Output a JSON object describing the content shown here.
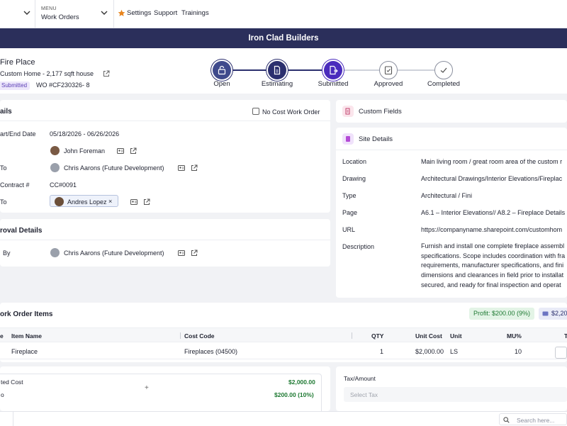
{
  "nav": {
    "menu_small": "MENU",
    "menu_label": "Work Orders",
    "links": [
      "Settings",
      "Support",
      "Trainings"
    ]
  },
  "company": "Iron Clad Builders",
  "header": {
    "title": "Fire Place",
    "subtitle": "Custom Home - 2,177 sqft house",
    "status_badge": "Submitted",
    "wo_number": "WO #CF230326- 8"
  },
  "stepper": {
    "steps": [
      "Open",
      "Estimating",
      "Submitted",
      "Approved",
      "Completed"
    ],
    "active_color": "#4a2bbd",
    "done_color": "#2b2f6e",
    "pending_color": "#8a8f9e"
  },
  "details": {
    "title": "ails",
    "no_cost_label": "No Cost Work Order",
    "rows": [
      {
        "label": "art/End Date",
        "value": "05/18/2026 - 06/26/2026"
      },
      {
        "label": "",
        "value": "John Foreman"
      },
      {
        "label": "To",
        "value": "Chris Aarons (Future Development)"
      },
      {
        "label": "Contract #",
        "value": "CC#0091"
      },
      {
        "label": "To",
        "value": "Andres Lopez"
      }
    ]
  },
  "approval": {
    "title": "roval Details",
    "label": "By",
    "value": "Chris Aarons (Future Development)"
  },
  "custom_fields": {
    "title": "Custom Fields"
  },
  "site_details": {
    "title": "Site Details",
    "rows": [
      {
        "label": "Location",
        "value": "Main living room / great room area of the custom r"
      },
      {
        "label": "Drawing",
        "value": "Architectural Drawings/Interior Elevations/Fireplac"
      },
      {
        "label": "Type",
        "value": "Architectural / Fini"
      },
      {
        "label": "Page",
        "value": "A6.1 – Interior Elevations// A8.2 – Fireplace Details"
      },
      {
        "label": "URL",
        "value": "https://companyname.sharepoint.com/customhom"
      }
    ],
    "description_label": "Description",
    "description_lines": [
      "Furnish and install one complete fireplace assembl",
      "specifications. Scope includes coordination with fra",
      "requirements, manufacturer specifications, and fini",
      "dimensions and clearances in field prior to installat",
      "secured, and ready for final inspection and operat"
    ]
  },
  "items": {
    "title": "ork Order Items",
    "profit_badge": "Profit: $200.00 (9%)",
    "total_badge": "$2,20",
    "columns": [
      "e",
      "Item Name",
      "Cost Code",
      "QTY",
      "Unit Cost",
      "Unit",
      "MU%",
      "T"
    ],
    "rows": [
      {
        "item": "Fireplace",
        "cost_code": "Fireplaces (04500)",
        "qty": "1",
        "unit_cost": "$2,000.00",
        "unit": "LS",
        "mu": "10"
      }
    ]
  },
  "summary": {
    "label1": "ted Cost",
    "value1": "$2,000.00",
    "label2": "o",
    "value2": "$200.00 (10%)"
  },
  "tax": {
    "label": "Tax/Amount",
    "placeholder": "Select Tax"
  },
  "search": {
    "placeholder": "Search here..."
  }
}
